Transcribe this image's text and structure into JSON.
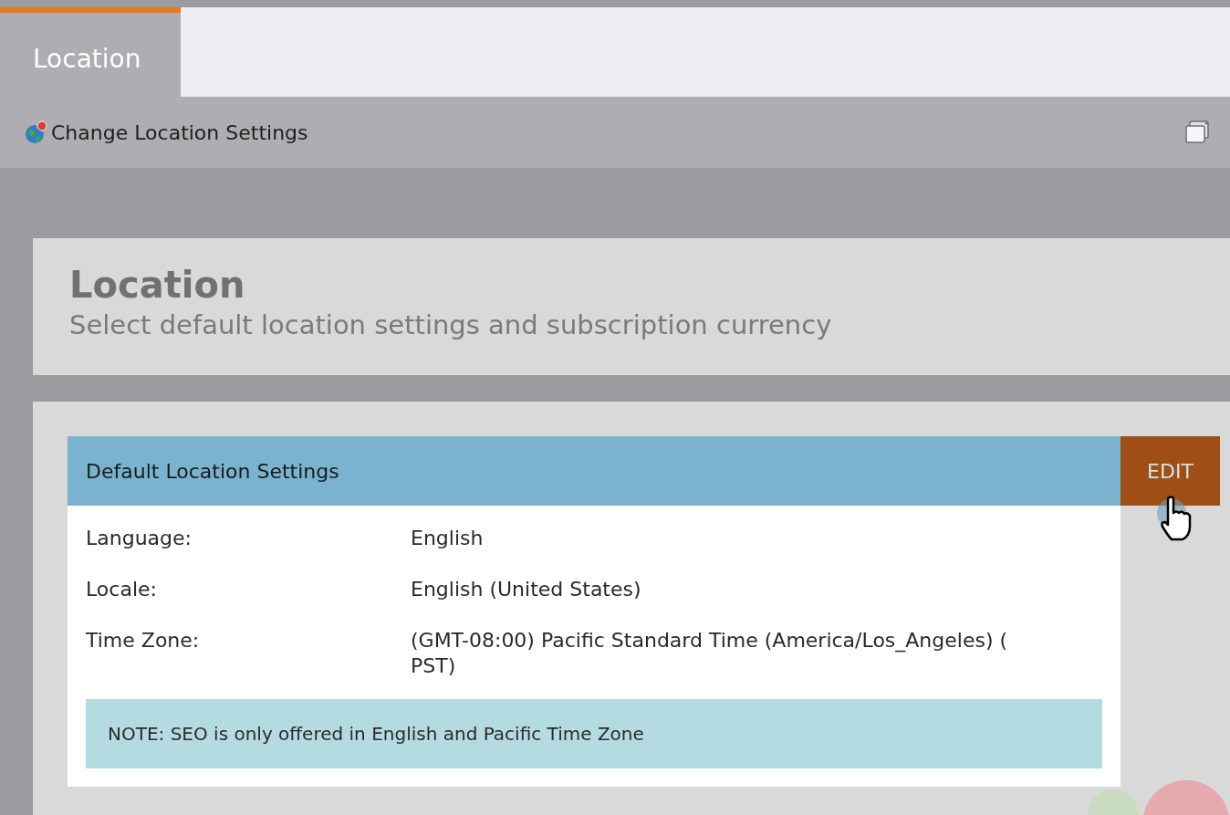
{
  "tabs": [
    {
      "label": "Location",
      "selected": true
    }
  ],
  "toolbar": {
    "title": "Change Location Settings"
  },
  "header": {
    "title": "Location",
    "subtitle": "Select default location settings and subscription currency"
  },
  "panel": {
    "title": "Default Location Settings",
    "edit_button": "EDIT",
    "fields": [
      {
        "label": "Language:",
        "value": "English"
      },
      {
        "label": "Locale:",
        "value": "English (United States)"
      },
      {
        "label": "Time Zone:",
        "value": "(GMT-08:00) Pacific Standard Time (America/Los_Angeles) ( PST)"
      }
    ],
    "note": "NOTE: SEO is only offered in English and Pacific Time Zone"
  }
}
